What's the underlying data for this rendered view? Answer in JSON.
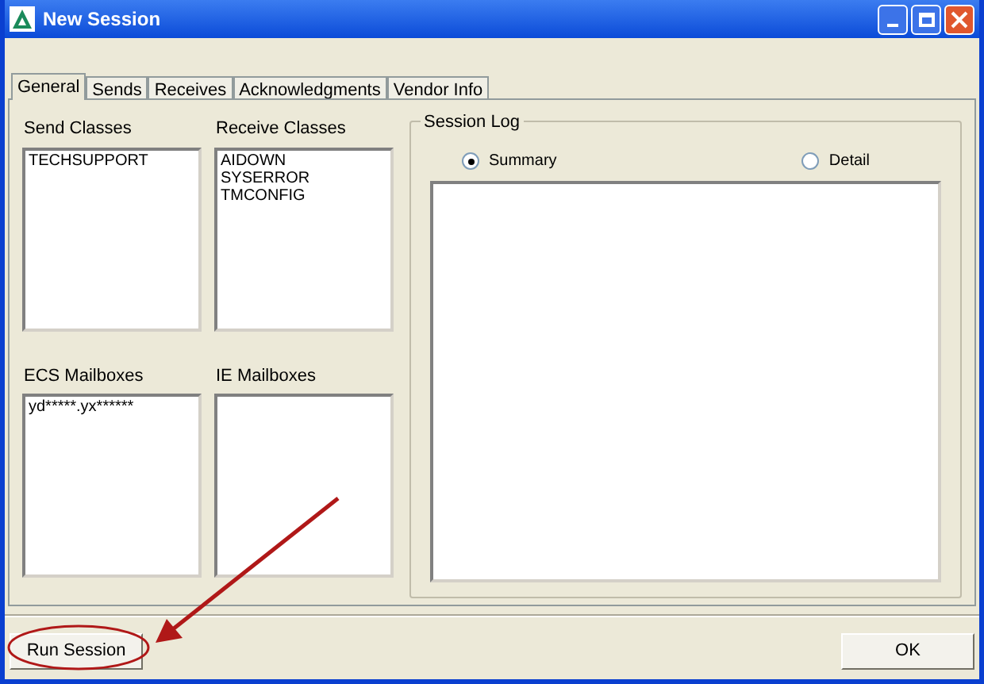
{
  "window": {
    "title": "New Session"
  },
  "tabs": [
    {
      "label": "General",
      "selected": true
    },
    {
      "label": "Sends",
      "selected": false
    },
    {
      "label": "Receives",
      "selected": false
    },
    {
      "label": "Acknowledgments",
      "selected": false
    },
    {
      "label": "Vendor Info",
      "selected": false
    }
  ],
  "send_classes": {
    "label": "Send Classes",
    "items": [
      "TECHSUPPORT"
    ]
  },
  "receive_classes": {
    "label": "Receive Classes",
    "items": [
      "AIDOWN",
      "SYSERROR",
      "TMCONFIG"
    ]
  },
  "ecs_mailboxes": {
    "label": "ECS Mailboxes",
    "items": [
      "yd*****.yx******"
    ]
  },
  "ie_mailboxes": {
    "label": "IE Mailboxes"
  },
  "session_log": {
    "label": "Session Log",
    "options": [
      {
        "label": "Summary",
        "selected": true
      },
      {
        "label": "Detail",
        "selected": false
      }
    ]
  },
  "buttons": [
    {
      "label": "Run Session",
      "highlighted": true
    },
    {
      "label": "OK",
      "highlighted": false
    }
  ]
}
